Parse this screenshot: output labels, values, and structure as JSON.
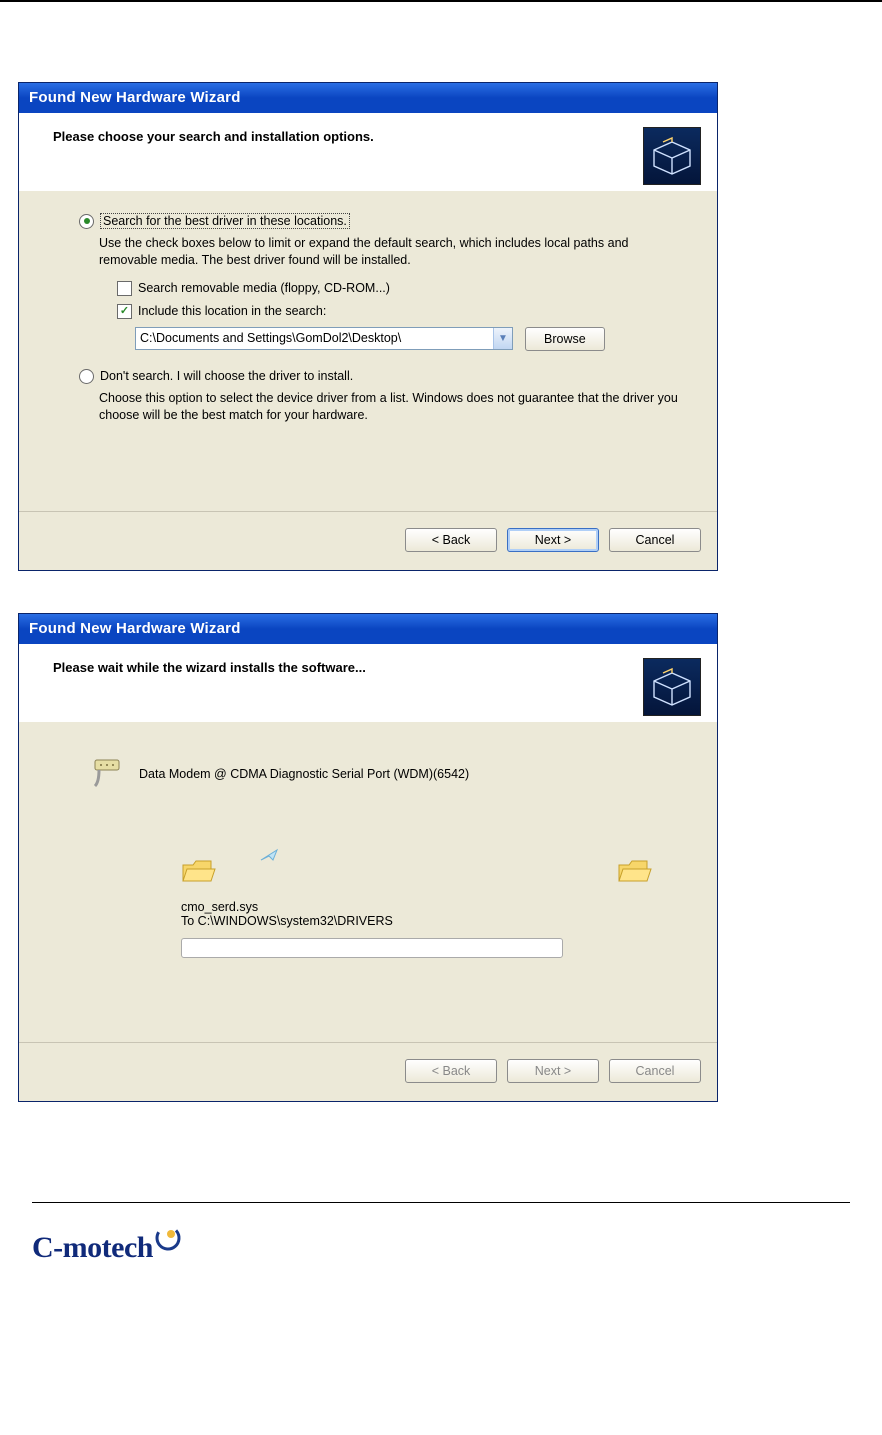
{
  "wizard1": {
    "title": "Found New Hardware Wizard",
    "header": "Please choose your search and installation options.",
    "option1": {
      "label": "Search for the best driver in these locations.",
      "selected": true,
      "description": "Use the check boxes below to limit or expand the default search, which includes local paths and removable media. The best driver found will be installed.",
      "checkbox1": {
        "label": "Search removable media (floppy, CD-ROM...)",
        "checked": false
      },
      "checkbox2": {
        "label": "Include this location in the search:",
        "checked": true
      },
      "path": "C:\\Documents and Settings\\GomDol2\\Desktop\\",
      "browse": "Browse"
    },
    "option2": {
      "label": "Don't search. I will choose the driver to install.",
      "selected": false,
      "description": "Choose this option to select the device driver from a list.  Windows does not guarantee that the driver you choose will be the best match for your hardware."
    },
    "buttons": {
      "back": "< Back",
      "next": "Next >",
      "cancel": "Cancel"
    }
  },
  "wizard2": {
    "title": "Found New Hardware Wizard",
    "header": "Please wait while the wizard installs the software...",
    "device": "Data Modem @ CDMA Diagnostic Serial Port (WDM)(6542)",
    "file": "cmo_serd.sys",
    "dest": "To C:\\WINDOWS\\system32\\DRIVERS",
    "buttons": {
      "back": "< Back",
      "next": "Next >",
      "cancel": "Cancel"
    }
  },
  "brand": "C-motech"
}
